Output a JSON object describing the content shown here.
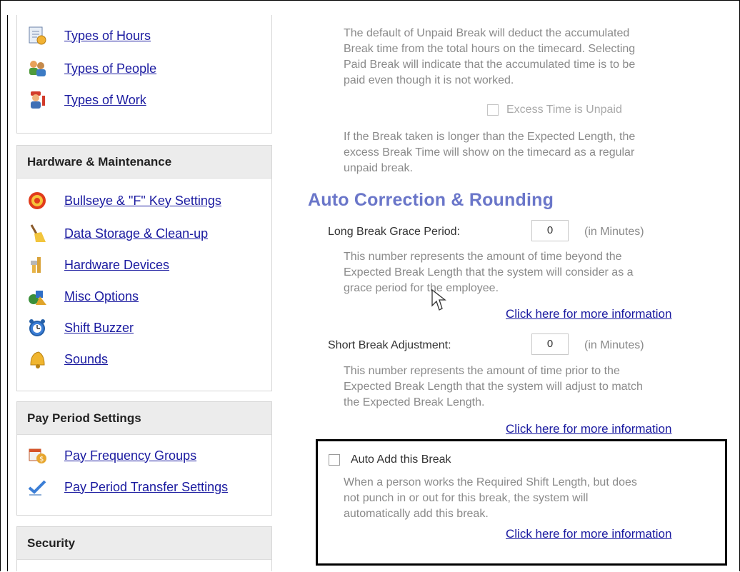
{
  "sidebar": {
    "top_items": [
      {
        "label": "Types of Hours",
        "icon": "document-clock-icon"
      },
      {
        "label": "Types of People",
        "icon": "people-icon"
      },
      {
        "label": "Types of Work",
        "icon": "worker-icon"
      }
    ],
    "hardware": {
      "title": "Hardware & Maintenance",
      "items": [
        {
          "label": "Bullseye & \"F\" Key Settings",
          "icon": "bullseye-icon"
        },
        {
          "label": "Data Storage & Clean-up",
          "icon": "broom-icon"
        },
        {
          "label": "Hardware Devices",
          "icon": "tools-icon"
        },
        {
          "label": "Misc Options",
          "icon": "shapes-icon"
        },
        {
          "label": "Shift Buzzer",
          "icon": "alarm-clock-icon"
        },
        {
          "label": "Sounds",
          "icon": "bell-icon"
        }
      ]
    },
    "pay_period": {
      "title": "Pay Period Settings",
      "items": [
        {
          "label": "Pay Frequency Groups",
          "icon": "calendar-money-icon"
        },
        {
          "label": "Pay Period Transfer Settings",
          "icon": "checkmark-pen-icon"
        }
      ]
    },
    "security": {
      "title": "Security"
    }
  },
  "content": {
    "paid_break_desc_1": "The default of Unpaid Break will deduct the accumulated",
    "paid_break_desc_2": "Break time from the total hours on the timecard.  Selecting",
    "paid_break_desc_3": "Paid Break will indicate that the accumulated time is to be",
    "paid_break_desc_4": "paid even though it is not worked.",
    "excess_label": "Excess Time is Unpaid",
    "excess_desc_1": "If the Break taken is longer than the Expected Length, the",
    "excess_desc_2": "excess Break Time will show on the timecard as a regular",
    "excess_desc_3": "unpaid break.",
    "section_title": "Auto Correction & Rounding",
    "long_break": {
      "label": "Long Break Grace Period:",
      "value": "0",
      "unit": "(in Minutes)",
      "desc_1": "This number represents the amount of time beyond the",
      "desc_2": "Expected Break Length that the system will consider as a",
      "desc_3": "grace period for the employee.",
      "more_link": "Click here for more information"
    },
    "short_break": {
      "label": "Short Break Adjustment:",
      "value": "0",
      "unit": "(in Minutes)",
      "desc_1": "This number represents the amount of time prior to the",
      "desc_2": "Expected Break Length that the system will adjust to match",
      "desc_3": "the Expected Break Length.",
      "more_link": "Click here for more information"
    },
    "auto_add": {
      "label": "Auto Add this Break",
      "desc_1": "When a person works the Required Shift Length, but does",
      "desc_2": "not punch in or out for this break, the system will",
      "desc_3": "automatically add this break.",
      "more_link": "Click here for more information"
    }
  }
}
